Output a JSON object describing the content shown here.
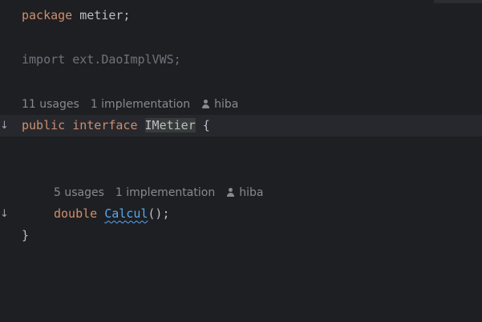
{
  "editor": {
    "code": {
      "package_kw": "package",
      "package_name": " metier;",
      "import_line": "import ext.DaoImplVWS;",
      "public_kw": "public",
      "interface_kw": " interface ",
      "interface_name": "IMetier",
      "brace_open": " {",
      "double_kw": "double",
      "method_name": "Calcul",
      "method_tail": "();",
      "brace_close": "}"
    },
    "hints": {
      "interface": {
        "usages": "11 usages",
        "implementations": "1 implementation",
        "author": "hiba"
      },
      "method": {
        "usages": "5 usages",
        "implementations": "1 implementation",
        "author": "hiba"
      }
    },
    "gutter": {
      "implemented_marker": "↓"
    }
  }
}
